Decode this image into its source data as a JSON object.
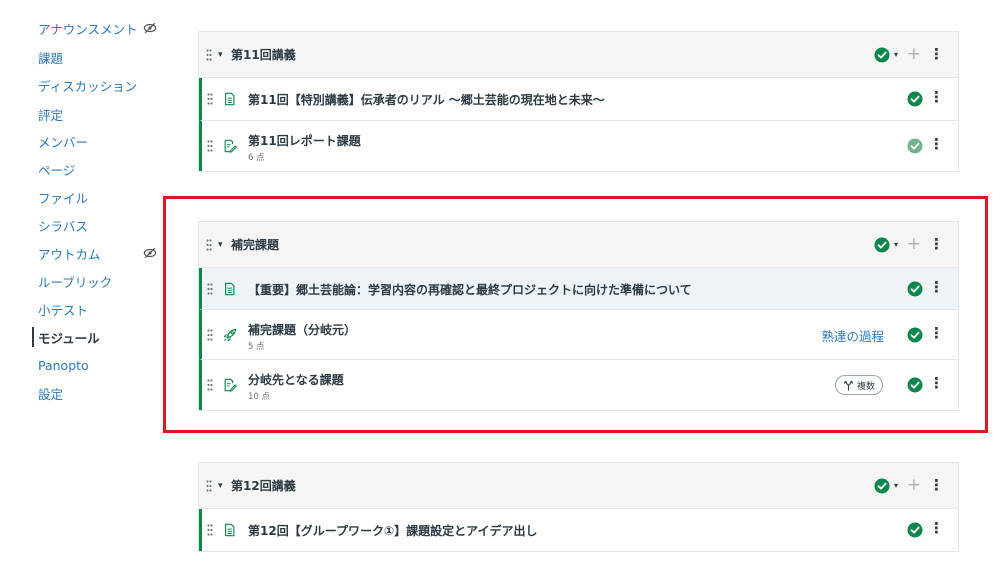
{
  "sidebar": {
    "items": [
      {
        "label": "アナウンスメント",
        "hidden": true
      },
      {
        "label": "課題"
      },
      {
        "label": "ディスカッション"
      },
      {
        "label": "評定"
      },
      {
        "label": "メンバー"
      },
      {
        "label": "ページ"
      },
      {
        "label": "ファイル"
      },
      {
        "label": "シラバス"
      },
      {
        "label": "アウトカム",
        "hidden": true
      },
      {
        "label": "ルーブリック"
      },
      {
        "label": "小テスト"
      },
      {
        "label": "モジュール",
        "active": true
      },
      {
        "label": "Panopto"
      },
      {
        "label": "設定"
      }
    ]
  },
  "modules": [
    {
      "title": "第11回講義",
      "items": [
        {
          "type": "page",
          "title": "第11回【特別講義】伝承者のリアル ～郷土芸能の現在地と未来～",
          "status": "published"
        },
        {
          "type": "assignment",
          "title": "第11回レポート課題",
          "points": "6 点",
          "status": "published-light"
        }
      ]
    },
    {
      "title": "補完課題",
      "items": [
        {
          "type": "page",
          "title": "【重要】郷土芸能論：学習内容の再確認と最終プロジェクトに向けた準備について",
          "status": "published"
        },
        {
          "type": "quiz",
          "title": "補完課題（分岐元）",
          "points": "5 点",
          "mastery": "熟達の過程",
          "status": "published"
        },
        {
          "type": "assignment",
          "title": "分岐先となる課題",
          "points": "10 点",
          "pill": "複数",
          "status": "published"
        }
      ]
    },
    {
      "title": "第12回講義",
      "items": [
        {
          "type": "page",
          "title": "第12回【グループワーク①】課題設定とアイデア出し",
          "status": "published"
        }
      ]
    }
  ],
  "icons": {
    "drag": "drag-handle-icon",
    "page": "document-icon",
    "assignment": "assignment-icon",
    "quiz": "rocket-icon",
    "published": "check-circle-icon",
    "hidden": "eye-slash-icon",
    "branch": "branch-icon"
  },
  "colors": {
    "link": "#2b7abc",
    "published": "#0b874b",
    "published_light": "#6fb38a",
    "highlight_border": "#d9181f"
  },
  "symbols": {
    "toggle": "▾",
    "caret": "▾",
    "add": "+",
    "kebab": "⋮"
  }
}
